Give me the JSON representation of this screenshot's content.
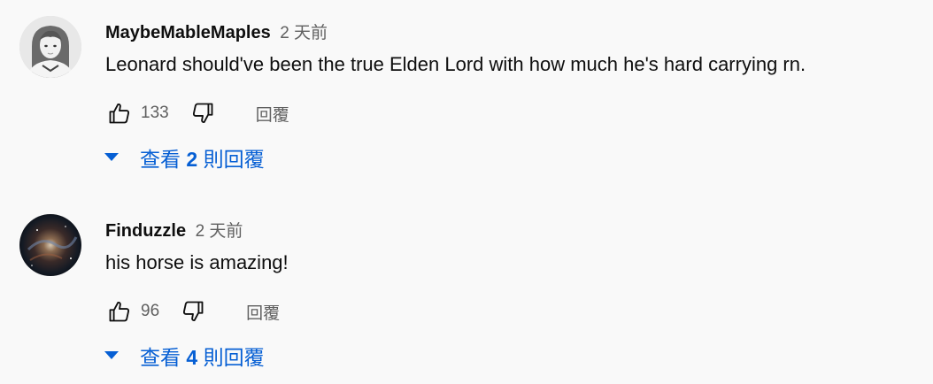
{
  "comments": [
    {
      "author": "MaybeMableMaples",
      "time": "2 天前",
      "text": "Leonard should've been the true Elden Lord with how much he's hard carrying rn.",
      "likes": "133",
      "reply_label": "回覆",
      "replies_prefix": "查看",
      "replies_count": "2",
      "replies_suffix": "則回覆",
      "avatar_icon": "user-photo-avatar"
    },
    {
      "author": "Finduzzle",
      "time": "2 天前",
      "text": "his horse is amazing!",
      "likes": "96",
      "reply_label": "回覆",
      "replies_prefix": "查看",
      "replies_count": "4",
      "replies_suffix": "則回覆",
      "avatar_icon": "galaxy-avatar"
    }
  ],
  "colors": {
    "background": "#f9f9f9",
    "text": "#0f0f0f",
    "secondary": "#606060",
    "accent": "#065fd4"
  },
  "icons": {
    "like": "thumbs-up-icon",
    "dislike": "thumbs-down-icon",
    "expand": "caret-down-icon"
  }
}
